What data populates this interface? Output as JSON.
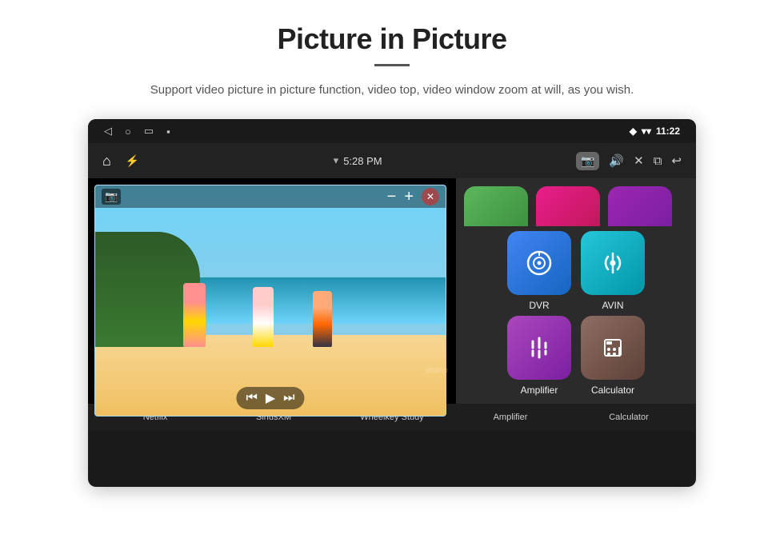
{
  "header": {
    "title": "Picture in Picture",
    "subtitle": "Support video picture in picture function, video top, video window zoom at will, as you wish."
  },
  "status_bar": {
    "time": "11:22",
    "wifi_icon": "▼",
    "location_icon": "◆"
  },
  "app_bar": {
    "time": "5:28 PM",
    "camera_icon": "📷",
    "volume_icon": "🔊"
  },
  "pip": {
    "minus": "−",
    "plus": "+",
    "close": "✕"
  },
  "video_controls": {
    "prev": "⏮",
    "play": "▶",
    "next": "⏭"
  },
  "apps": {
    "top_row": [
      {
        "id": "netflix",
        "color": "green",
        "label": "Netflix"
      },
      {
        "id": "siriusxm",
        "color": "pink",
        "label": "SiriusXM"
      },
      {
        "id": "wheelkey",
        "color": "purple-light",
        "label": "Wheelkey Study"
      }
    ],
    "bottom_row": [
      {
        "id": "dvr",
        "color": "blue",
        "label": "DVR",
        "icon": "◎"
      },
      {
        "id": "avin",
        "color": "teal",
        "label": "AVIN",
        "icon": "🔌"
      }
    ],
    "third_row": [
      {
        "id": "amplifier",
        "color": "purple",
        "label": "Amplifier",
        "icon": "⚙"
      },
      {
        "id": "calculator",
        "color": "brown",
        "label": "Calculator",
        "icon": "🔢"
      }
    ]
  },
  "bottom_labels": [
    "Netflix",
    "SiriusXM",
    "Wheelkey Study",
    "Amplifier",
    "Calculator"
  ],
  "watermark": "viczno"
}
